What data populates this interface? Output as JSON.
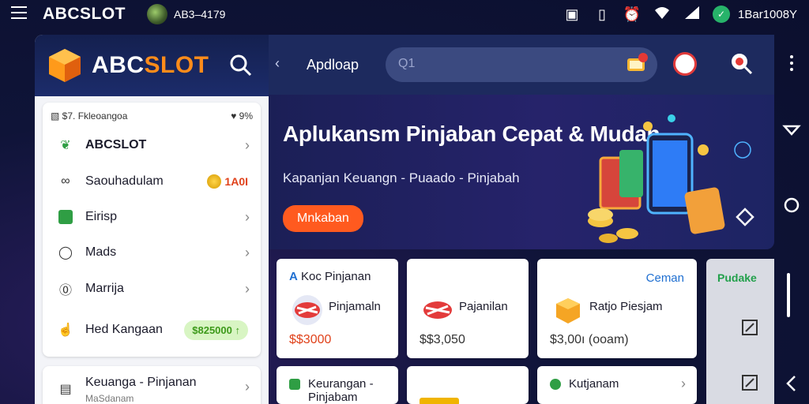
{
  "statusbar": {
    "brand": "ABCSLOT",
    "user": "AB3–4179",
    "account": "1Bar1008Y",
    "icons": [
      "menu-icon",
      "screenshot-icon",
      "battery-saver-icon",
      "alarm-icon",
      "wifi-icon",
      "signal-icon",
      "shield-icon"
    ]
  },
  "sidebar": {
    "logo_main": "ABC",
    "logo_accent": "SLOT",
    "card_top_left": "▧ $7. Fkleoangoa",
    "card_top_right": "♥ 9%",
    "items": [
      {
        "label": "ABCSLOT",
        "icon": "leaf-icon"
      },
      {
        "label": "Saouhadulam",
        "icon": "link-icon",
        "badge": "1A0I"
      },
      {
        "label": "Eirisp",
        "icon": "chart-icon"
      },
      {
        "label": "Mads",
        "icon": "chat-icon"
      },
      {
        "label": "Marrija",
        "icon": "coin-icon"
      },
      {
        "label": "Hed Kangaan",
        "icon": "hand-icon",
        "pill": "$825000 ↑"
      }
    ],
    "bottom_item": {
      "label": "Keuanga - Pinjanan",
      "sub": "MaSdanam",
      "icon": "wallet-icon"
    }
  },
  "topbar": {
    "title": "Apdloap",
    "search_placeholder": "Q1"
  },
  "hero": {
    "title": "Aplukansm Pinjaban Cepat & Mudah",
    "subtitle": "Kapanjan Keuangn - Puaado - Pinjabah",
    "button": "Mnkaban"
  },
  "products": [
    {
      "head": "Koc Pinjanan",
      "name": "Pinjamaln",
      "price": "$$3000",
      "hot": true
    },
    {
      "head": "",
      "name": "Pajanilan",
      "price": "$$3,050",
      "hot": false
    },
    {
      "head": "Ceman",
      "name": "Ratjo Piesjam",
      "price": "$3,00ı (ooam)",
      "hot": false
    }
  ],
  "products_row2": [
    {
      "head": "Keurangan - Pinjabam",
      "color": "#2f9e44"
    },
    {
      "head": "",
      "color": "#f0b400"
    },
    {
      "head": "Kutjanam",
      "color": "#2f9e44"
    }
  ],
  "rightpanel": {
    "label": "Pudake"
  }
}
